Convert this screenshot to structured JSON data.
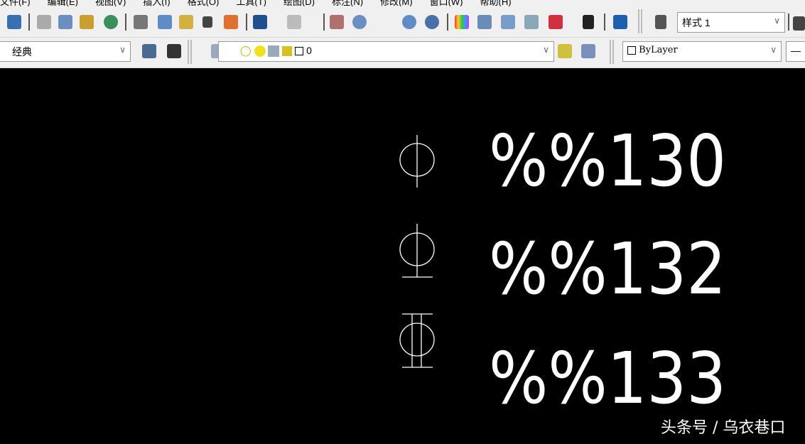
{
  "menu": [
    "文件(F)",
    "编辑(E)",
    "视图(V)",
    "插入(I)",
    "格式(O)",
    "工具(T)",
    "绘图(D)",
    "标注(N)",
    "修改(M)",
    "窗口(W)",
    "帮助(H)"
  ],
  "toolbar1": {
    "icons": [
      "save-icon",
      "plot-icon",
      "plot-preview-icon",
      "publish-icon",
      "3d-dwf-icon",
      "cut-icon",
      "copy-icon",
      "paste-icon",
      "match-properties-icon",
      "block-editor-icon",
      "undo-icon",
      "redo-icon",
      "pan-icon",
      "zoom-realtime-icon",
      "zoom-window-icon",
      "zoom-previous-icon",
      "properties-icon",
      "design-center-icon",
      "tool-palettes-icon",
      "sheet-set-icon",
      "markup-icon",
      "calculator-icon",
      "help-icon",
      "text-style-icon"
    ],
    "text_style": "样式 1"
  },
  "toolbar2": {
    "workspace": "经典",
    "layer": "0",
    "color": "ByLayer"
  },
  "drawing": {
    "rows": [
      {
        "symbol": "diameter",
        "code": "%%130"
      },
      {
        "symbol": "diameter-bar-below",
        "code": "%%132"
      },
      {
        "symbol": "diameter-bars-both",
        "code": "%%133"
      }
    ],
    "stroke_color": "#ffffff",
    "background": "#000000"
  },
  "watermark": "头条号 / 乌衣巷口"
}
